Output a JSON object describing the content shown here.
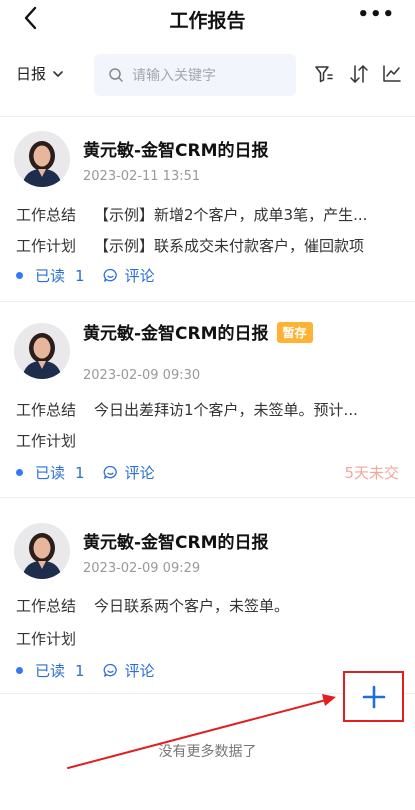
{
  "header": {
    "title": "工作报告",
    "more_label": "•••"
  },
  "filter": {
    "type_label": "日报",
    "search_placeholder": "请输入关键字"
  },
  "reports": [
    {
      "name": "黄元敏-金智CRM的日报",
      "badge": "",
      "time": "2023-02-11 13:51",
      "summary_label": "工作总结",
      "summary": "【示例】新增2个客户，成单3笔，产生...",
      "plan_label": "工作计划",
      "plan": "【示例】联系成交未付款客户，催回款项",
      "read_label": "已读",
      "read_count": "1",
      "comment_label": "评论",
      "status": ""
    },
    {
      "name": "黄元敏-金智CRM的日报",
      "badge": "暂存",
      "time": "2023-02-09 09:30",
      "summary_label": "工作总结",
      "summary": "今日出差拜访1个客户，未签单。预计...",
      "plan_label": "工作计划",
      "plan": "",
      "read_label": "已读",
      "read_count": "1",
      "comment_label": "评论",
      "status": "5天未交"
    },
    {
      "name": "黄元敏-金智CRM的日报",
      "badge": "",
      "time": "2023-02-09 09:29",
      "summary_label": "工作总结",
      "summary": "今日联系两个客户，未签单。",
      "plan_label": "工作计划",
      "plan": "",
      "read_label": "已读",
      "read_count": "1",
      "comment_label": "评论",
      "status": ""
    }
  ],
  "fab": {
    "label": "+"
  },
  "footer": {
    "no_more": "没有更多数据了"
  },
  "colors": {
    "accent": "#2a6fd6",
    "badge": "#ffb233",
    "overdue": "#f2a79a",
    "highlight": "#e02020"
  }
}
